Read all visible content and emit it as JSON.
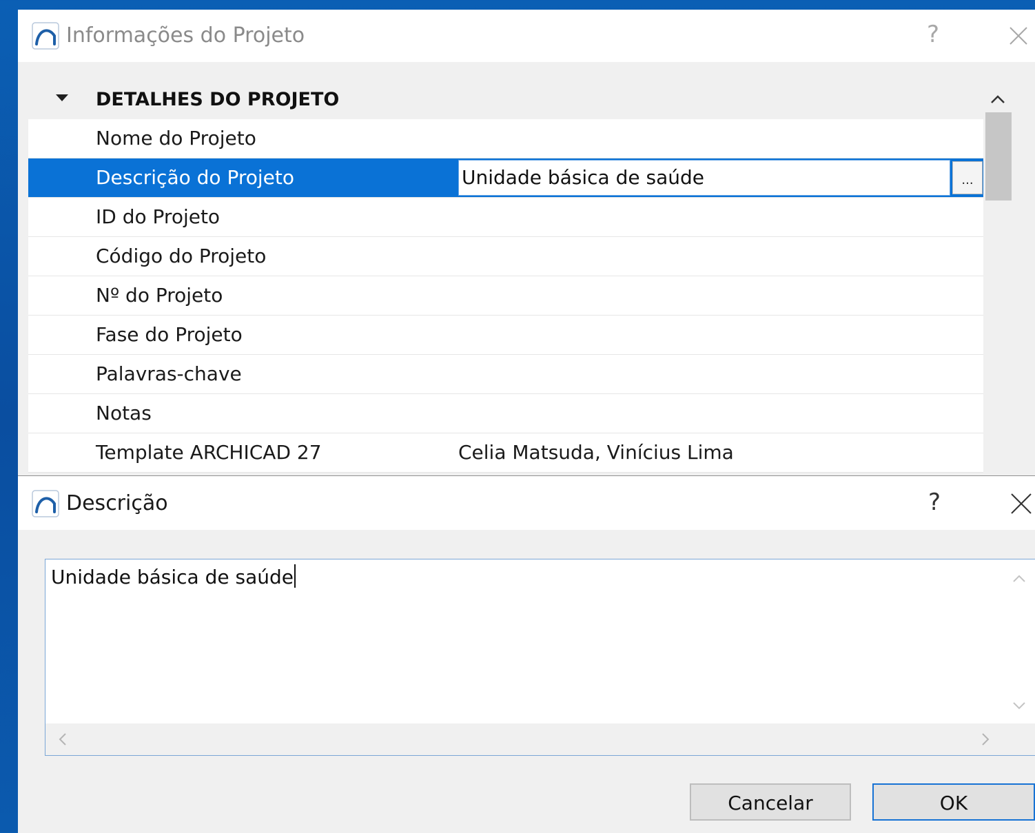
{
  "info_dialog": {
    "title": "Informações do Projeto",
    "help": "?",
    "group": {
      "label": "DETALHES DO PROJETO",
      "rows": [
        {
          "label": "Nome do Projeto",
          "value": ""
        },
        {
          "label": "Descrição do Projeto",
          "value": "Unidade básica de saúde",
          "selected": true,
          "more": "..."
        },
        {
          "label": "ID do Projeto",
          "value": ""
        },
        {
          "label": "Código do Projeto",
          "value": ""
        },
        {
          "label": "Nº do Projeto",
          "value": ""
        },
        {
          "label": "Fase do Projeto",
          "value": ""
        },
        {
          "label": "Palavras-chave",
          "value": ""
        },
        {
          "label": "Notas",
          "value": ""
        },
        {
          "label": "Template ARCHICAD 27",
          "value": "Celia Matsuda, Vinícius Lima"
        }
      ]
    }
  },
  "desc_dialog": {
    "title": "Descrição",
    "help": "?",
    "text": "Unidade básica de saúde",
    "cancel_label": "Cancelar",
    "ok_label": "OK"
  },
  "icons": {
    "app": "archicad-logo-icon",
    "close": "close-icon",
    "expand": "caret-down-icon"
  },
  "colors": {
    "selection": "#0a72d6",
    "desktop": "#0b5fb4",
    "ok_border": "#1672d4"
  }
}
